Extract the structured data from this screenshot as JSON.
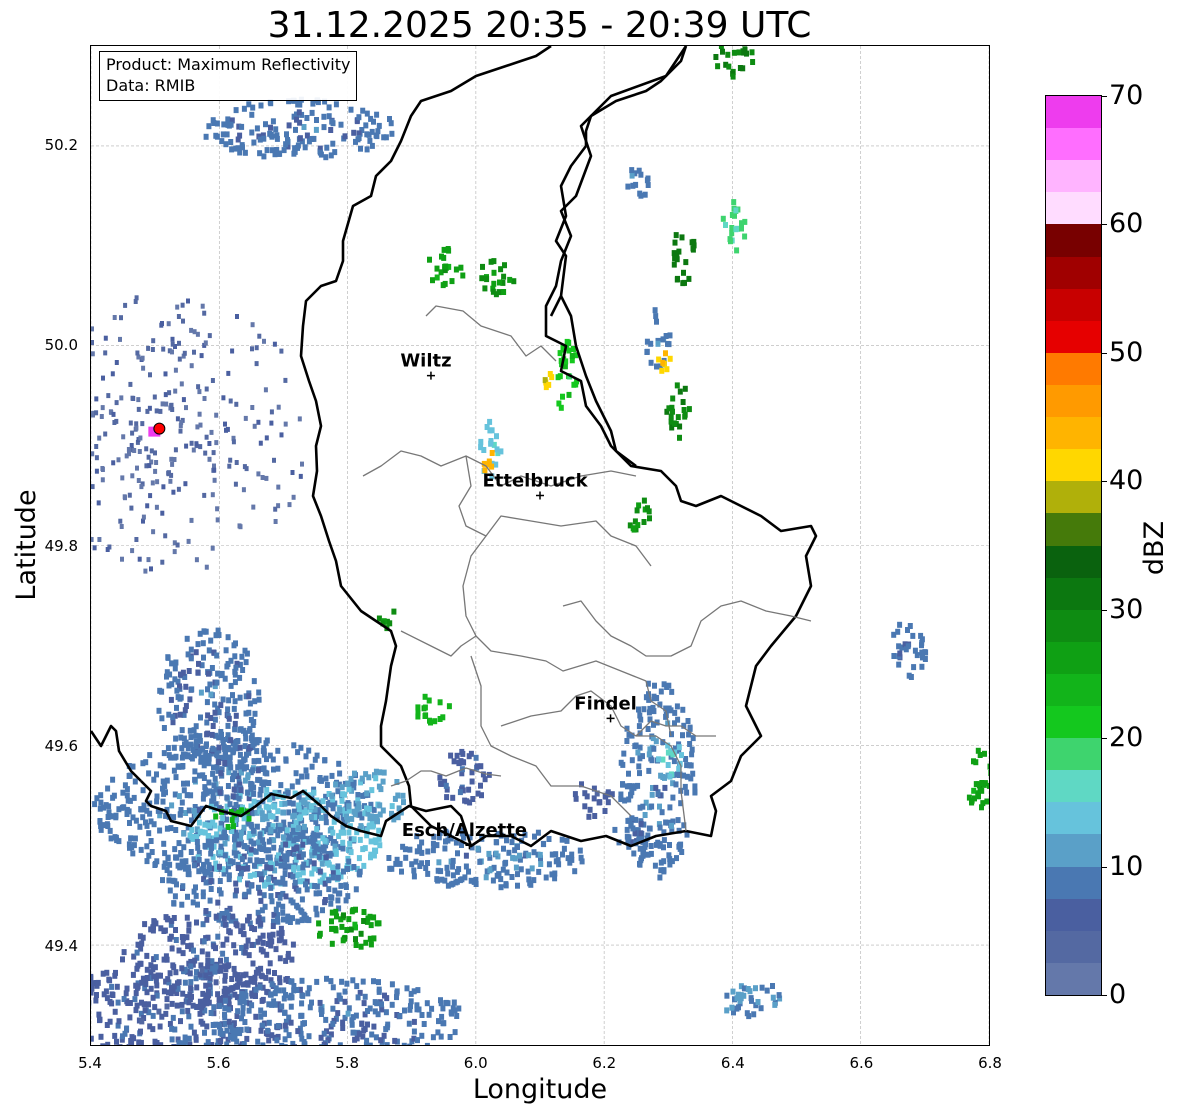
{
  "title": "31.12.2025 20:35 - 20:39 UTC",
  "info": {
    "product": "Product: Maximum Reflectivity",
    "data": "Data: RMIB"
  },
  "axes": {
    "xlabel": "Longitude",
    "ylabel": "Latitude",
    "xlim": [
      5.4,
      6.8
    ],
    "ylim": [
      49.3,
      50.3
    ],
    "xticks": [
      "5.4",
      "5.6",
      "5.8",
      "6.0",
      "6.2",
      "6.4",
      "6.6",
      "6.8"
    ],
    "yticks": [
      "49.4",
      "49.6",
      "49.8",
      "50.0",
      "50.2"
    ],
    "grid": true
  },
  "colorbar": {
    "label": "dBZ",
    "ticks": [
      "0",
      "10",
      "20",
      "30",
      "40",
      "50",
      "60",
      "70"
    ],
    "range": [
      0,
      70
    ],
    "step": 2.5,
    "colors": [
      "#6478aa",
      "#5469a2",
      "#4a5fa0",
      "#4a78b2",
      "#5aa0c8",
      "#66c3dc",
      "#5fd8c4",
      "#3ed46e",
      "#14c81e",
      "#12b41a",
      "#0fa014",
      "#0e8c12",
      "#0c7810",
      "#0a620e",
      "#457a0a",
      "#b0b00a",
      "#ffd700",
      "#ffb400",
      "#ff9a00",
      "#ff7a00",
      "#e60000",
      "#c80000",
      "#a00000",
      "#780000",
      "#ffdcff",
      "#ffb4ff",
      "#ff6eff",
      "#ee3cee"
    ]
  },
  "cities": [
    {
      "name": "Wiltz",
      "lon": 5.93,
      "lat": 49.97
    },
    {
      "name": "Ettelbruck",
      "lon": 6.1,
      "lat": 49.85
    },
    {
      "name": "Findel",
      "lon": 6.21,
      "lat": 49.627
    },
    {
      "name": "Esch/Alzette",
      "lon": 5.99,
      "lat": 49.5
    }
  ],
  "radar_site": {
    "lon": 5.505,
    "lat": 49.915,
    "color": "#ff0000"
  },
  "echoes": [
    {
      "lon": 5.62,
      "lat": 49.54,
      "dlon": 0.22,
      "dlat": 0.07,
      "dbz": 9
    },
    {
      "lon": 5.7,
      "lat": 49.51,
      "dlon": 0.15,
      "dlat": 0.05,
      "dbz": 13
    },
    {
      "lon": 5.62,
      "lat": 49.53,
      "dlon": 0.03,
      "dlat": 0.01,
      "dbz": 24
    },
    {
      "lon": 5.66,
      "lat": 49.47,
      "dlon": 0.16,
      "dlat": 0.05,
      "dbz": 8
    },
    {
      "lon": 5.58,
      "lat": 49.65,
      "dlon": 0.08,
      "dlat": 0.07,
      "dbz": 8
    },
    {
      "lon": 5.62,
      "lat": 49.58,
      "dlon": 0.06,
      "dlat": 0.04,
      "dbz": 8
    },
    {
      "lon": 5.83,
      "lat": 49.55,
      "dlon": 0.06,
      "dlat": 0.03,
      "dbz": 12
    },
    {
      "lon": 5.52,
      "lat": 49.33,
      "dlon": 0.18,
      "dlat": 0.06,
      "dbz": 7
    },
    {
      "lon": 5.58,
      "lat": 49.39,
      "dlon": 0.14,
      "dlat": 0.05,
      "dbz": 7
    },
    {
      "lon": 5.78,
      "lat": 49.33,
      "dlon": 0.2,
      "dlat": 0.04,
      "dbz": 8
    },
    {
      "lon": 5.8,
      "lat": 49.42,
      "dlon": 0.06,
      "dlat": 0.02,
      "dbz": 27
    },
    {
      "lon": 6.01,
      "lat": 49.49,
      "dlon": 0.16,
      "dlat": 0.03,
      "dbz": 9
    },
    {
      "lon": 5.98,
      "lat": 49.57,
      "dlon": 0.04,
      "dlat": 0.03,
      "dbz": 7
    },
    {
      "lon": 6.28,
      "lat": 49.57,
      "dlon": 0.06,
      "dlat": 0.1,
      "dbz": 9
    },
    {
      "lon": 6.3,
      "lat": 49.59,
      "dlon": 0.02,
      "dlat": 0.02,
      "dbz": 15
    },
    {
      "lon": 6.24,
      "lat": 49.52,
      "dlon": 0.03,
      "dlat": 0.02,
      "dbz": 8
    },
    {
      "lon": 6.42,
      "lat": 49.35,
      "dlon": 0.05,
      "dlat": 0.02,
      "dbz": 10
    },
    {
      "lon": 6.25,
      "lat": 49.83,
      "dlon": 0.02,
      "dlat": 0.02,
      "dbz": 28
    },
    {
      "lon": 6.28,
      "lat": 50.01,
      "dlon": 0.02,
      "dlat": 0.03,
      "dbz": 9
    },
    {
      "lon": 6.29,
      "lat": 49.99,
      "dlon": 0.01,
      "dlat": 0.02,
      "dbz": 42
    },
    {
      "lon": 6.31,
      "lat": 49.94,
      "dlon": 0.02,
      "dlat": 0.03,
      "dbz": 30
    },
    {
      "lon": 6.32,
      "lat": 50.09,
      "dlon": 0.02,
      "dlat": 0.03,
      "dbz": 32
    },
    {
      "lon": 6.14,
      "lat": 49.97,
      "dlon": 0.02,
      "dlat": 0.04,
      "dbz": 22
    },
    {
      "lon": 6.11,
      "lat": 49.97,
      "dlon": 0.01,
      "dlat": 0.01,
      "dbz": 40
    },
    {
      "lon": 6.02,
      "lat": 49.9,
      "dlon": 0.02,
      "dlat": 0.03,
      "dbz": 14
    },
    {
      "lon": 6.015,
      "lat": 49.89,
      "dlon": 0.008,
      "dlat": 0.015,
      "dbz": 44
    },
    {
      "lon": 5.95,
      "lat": 50.08,
      "dlon": 0.03,
      "dlat": 0.02,
      "dbz": 26
    },
    {
      "lon": 6.03,
      "lat": 50.07,
      "dlon": 0.03,
      "dlat": 0.02,
      "dbz": 28
    },
    {
      "lon": 6.25,
      "lat": 50.17,
      "dlon": 0.02,
      "dlat": 0.02,
      "dbz": 9
    },
    {
      "lon": 6.4,
      "lat": 50.29,
      "dlon": 0.03,
      "dlat": 0.02,
      "dbz": 30
    },
    {
      "lon": 6.4,
      "lat": 50.12,
      "dlon": 0.02,
      "dlat": 0.03,
      "dbz": 18
    },
    {
      "lon": 5.93,
      "lat": 49.64,
      "dlon": 0.03,
      "dlat": 0.015,
      "dbz": 24
    },
    {
      "lon": 5.86,
      "lat": 49.73,
      "dlon": 0.02,
      "dlat": 0.01,
      "dbz": 28
    },
    {
      "lon": 6.67,
      "lat": 49.7,
      "dlon": 0.03,
      "dlat": 0.03,
      "dbz": 8
    },
    {
      "lon": 6.78,
      "lat": 49.57,
      "dlon": 0.02,
      "dlat": 0.04,
      "dbz": 26
    },
    {
      "lon": 5.72,
      "lat": 50.22,
      "dlon": 0.15,
      "dlat": 0.03,
      "dbz": 8
    },
    {
      "lon": 6.18,
      "lat": 49.55,
      "dlon": 0.03,
      "dlat": 0.02,
      "dbz": 6
    }
  ]
}
